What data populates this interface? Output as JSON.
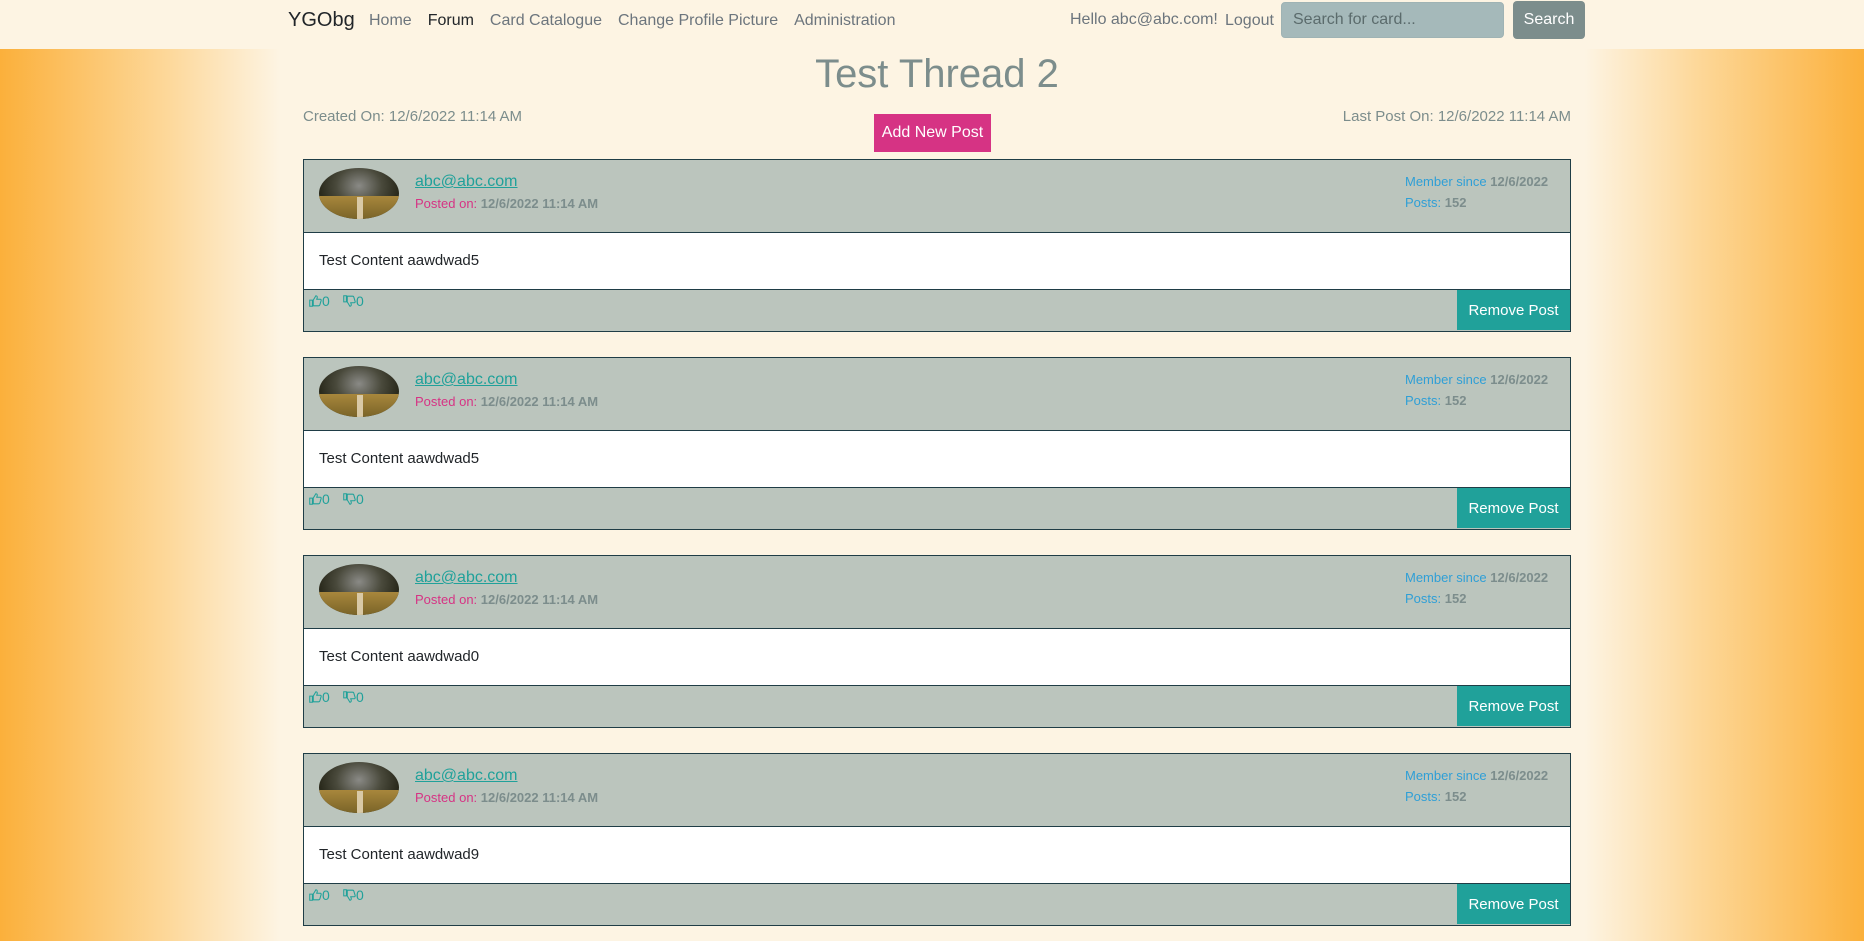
{
  "nav": {
    "brand": "YGObg",
    "links": [
      "Home",
      "Forum",
      "Card Catalogue",
      "Change Profile Picture",
      "Administration"
    ],
    "active_link": "Forum",
    "greeting": "Hello abc@abc.com!",
    "logout": "Logout",
    "search_placeholder": "Search for card...",
    "search_button": "Search"
  },
  "thread": {
    "title": "Test Thread 2",
    "created": "Created On: 12/6/2022 11:14 AM",
    "last_post": "Last Post On: 12/6/2022 11:14 AM",
    "add_post_button": "Add New Post"
  },
  "posts": [
    {
      "author": "abc@abc.com",
      "posted_label": "Posted on:",
      "posted_date": "12/6/2022 11:14 AM",
      "member_label": "Member since",
      "member_date": "12/6/2022",
      "posts_label": "Posts:",
      "posts_count": "152",
      "content": "Test Content aawdwad5",
      "likes": "0",
      "dislikes": "0",
      "remove_button": "Remove Post"
    },
    {
      "author": "abc@abc.com",
      "posted_label": "Posted on:",
      "posted_date": "12/6/2022 11:14 AM",
      "member_label": "Member since",
      "member_date": "12/6/2022",
      "posts_label": "Posts:",
      "posts_count": "152",
      "content": "Test Content aawdwad5",
      "likes": "0",
      "dislikes": "0",
      "remove_button": "Remove Post"
    },
    {
      "author": "abc@abc.com",
      "posted_label": "Posted on:",
      "posted_date": "12/6/2022 11:14 AM",
      "member_label": "Member since",
      "member_date": "12/6/2022",
      "posts_label": "Posts:",
      "posts_count": "152",
      "content": "Test Content aawdwad0",
      "likes": "0",
      "dislikes": "0",
      "remove_button": "Remove Post"
    },
    {
      "author": "abc@abc.com",
      "posted_label": "Posted on:",
      "posted_date": "12/6/2022 11:14 AM",
      "member_label": "Member since",
      "member_date": "12/6/2022",
      "posts_label": "Posts:",
      "posts_count": "152",
      "content": "Test Content aawdwad9",
      "likes": "0",
      "dislikes": "0",
      "remove_button": "Remove Post"
    }
  ],
  "colors": {
    "accent_pink": "#d63384",
    "accent_teal": "#20a19a",
    "post_header_bg": "#bbc5bd",
    "page_bg": "#fdf4e3"
  },
  "icons": {
    "like": "thumbs-up-icon",
    "dislike": "thumbs-down-icon",
    "avatar": "avatar"
  }
}
